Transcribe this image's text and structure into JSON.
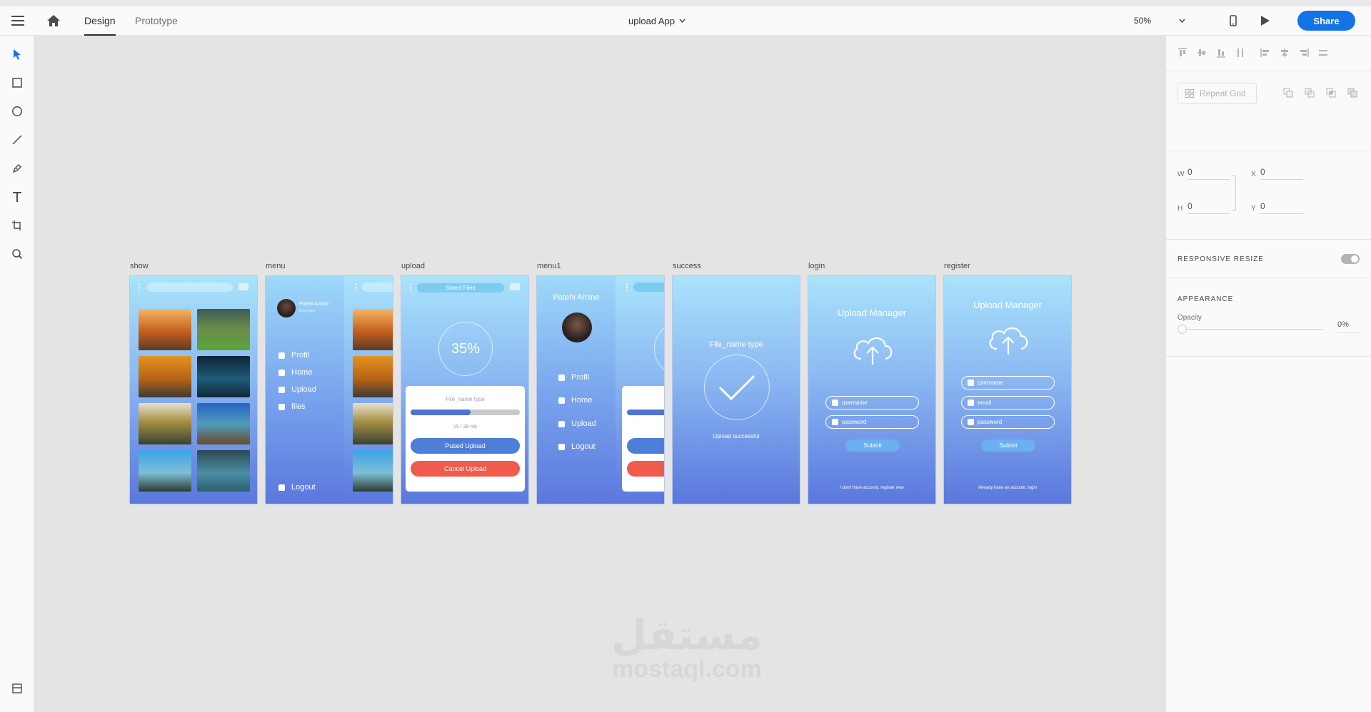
{
  "topbar": {
    "tab_design": "Design",
    "tab_prototype": "Prototype",
    "doc_title": "upload App",
    "zoom": "50%",
    "share": "Share"
  },
  "tools": [
    "select-tool",
    "rectangle-tool",
    "ellipse-tool",
    "line-tool",
    "pen-tool",
    "text-tool",
    "artboard-tool",
    "zoom-tool"
  ],
  "rpanel": {
    "repeat_grid": "Repeat Grid",
    "w_label": "W",
    "w_value": "0",
    "h_label": "H",
    "h_value": "0",
    "x_label": "X",
    "x_value": "0",
    "y_label": "Y",
    "y_value": "0",
    "responsive": "RESPONSIVE RESIZE",
    "appearance": "APPEARANCE",
    "opacity_label": "Opacity",
    "opacity_value": "0%"
  },
  "artboards": {
    "show": {
      "name": "show"
    },
    "menu": {
      "name": "menu",
      "user_name": "Patehi Amine",
      "user_sub": "Developer",
      "items": [
        "Profil",
        "Home",
        "Upload",
        "files"
      ],
      "logout": "Logout"
    },
    "upload": {
      "name": "upload",
      "select_files": "Select Files",
      "percent": "35%",
      "progress": 0.55,
      "file_name": "File_name type",
      "size": "15 / 38 mb",
      "pause": "Pused Upload",
      "cancel": "Cancel Upload"
    },
    "menu1": {
      "name": "menu1",
      "user_name": "Patehi Amine",
      "items": [
        "Profil",
        "Home",
        "Upload",
        "Logout"
      ]
    },
    "success": {
      "name": "success",
      "file_name": "File_name type",
      "message": "Upload successful"
    },
    "login": {
      "name": "login",
      "title": "Upload Manager",
      "username": "username",
      "password": "password",
      "submit": "Submit",
      "footer": "I don't have account, register new"
    },
    "register": {
      "name": "register",
      "title": "Upload Manager",
      "username": "username",
      "email": "email",
      "password": "password",
      "submit": "Submit",
      "footer": "Already have an account, login"
    }
  },
  "watermark": {
    "arabic": "مستقل",
    "latin": "mostaql.com"
  }
}
